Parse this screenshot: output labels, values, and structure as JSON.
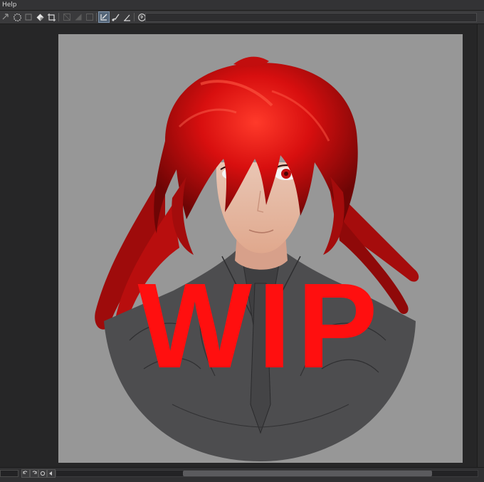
{
  "menubar": {
    "items": [
      "Help"
    ]
  },
  "toolbar": {
    "tools": [
      "arrow-icon",
      "dotted-circle-select-icon",
      "square-select-icon",
      "fill-icon",
      "crop-icon",
      "disabled-transform-icon",
      "disabled-triangle-icon",
      "disabled-square-icon",
      "ruler-pen-icon",
      "brush-icon",
      "ruler-icon",
      "spiral-icon"
    ],
    "active_tool": "ruler-pen-icon"
  },
  "artwork": {
    "overlay_text": "WIP",
    "overlay_color": "#ff0f0f",
    "hair_color": "#c8100f",
    "background_color": "#979797",
    "coat_color": "#4d4d4f"
  },
  "statusbar": {
    "zoom_value": "",
    "nav_buttons": [
      "rotate-left-icon",
      "rotate-right-icon",
      "reset-rotation-icon",
      "flip-icon"
    ]
  }
}
